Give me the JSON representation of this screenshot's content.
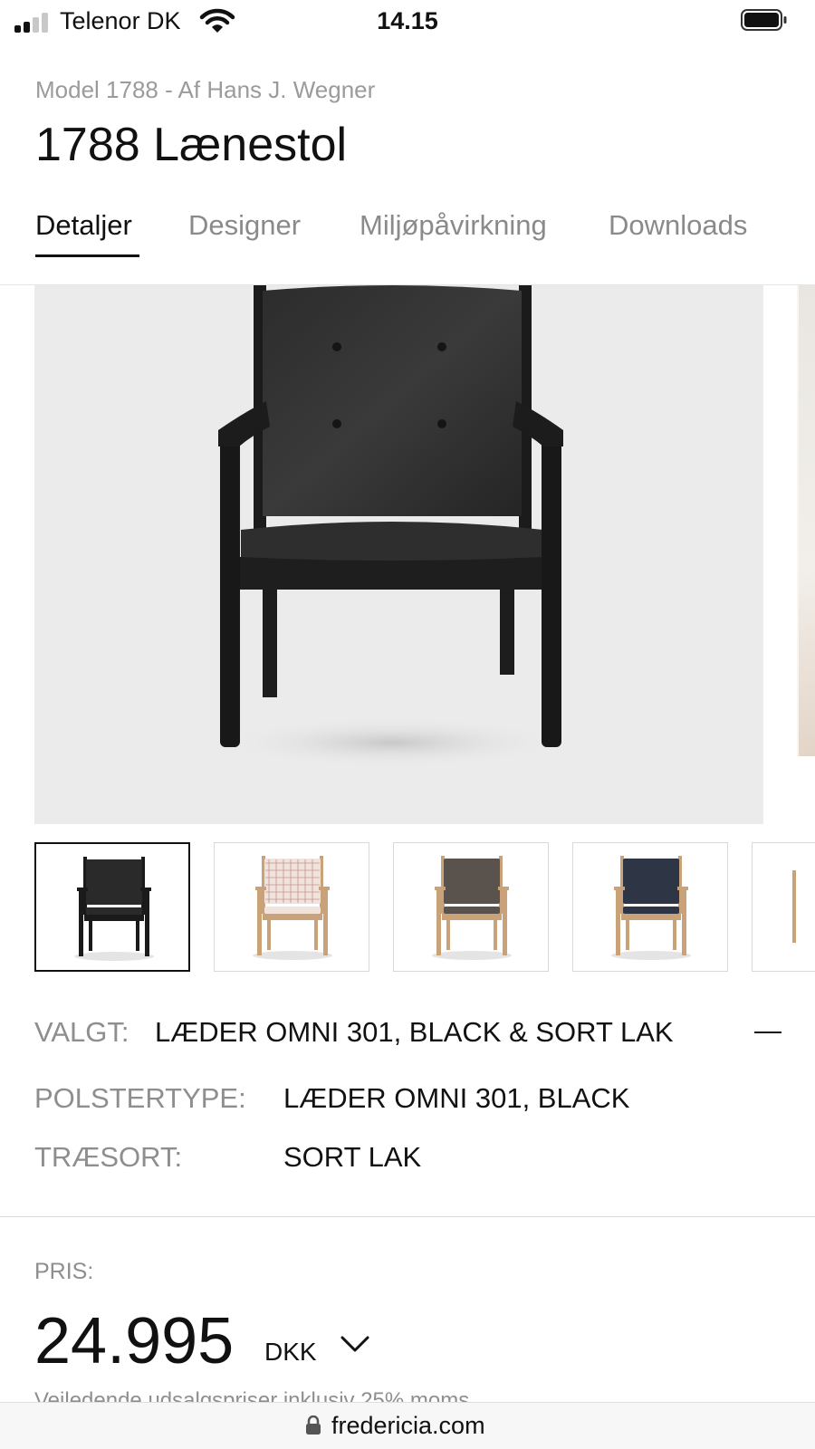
{
  "status_bar": {
    "carrier": "Telenor DK",
    "time": "14.15"
  },
  "product": {
    "subtitle": "Model 1788 - Af Hans J. Wegner",
    "title": "1788 Lænestol"
  },
  "tabs": [
    {
      "label": "Detaljer",
      "active": true
    },
    {
      "label": "Designer",
      "active": false
    },
    {
      "label": "Miljøpåvirkning",
      "active": false
    },
    {
      "label": "Downloads",
      "active": false
    }
  ],
  "gallery": {
    "hero_icon": "black-leather-armchair",
    "thumbnails": [
      {
        "icon": "black-leather-armchair-thumb",
        "selected": true,
        "frame": "#1a1a1a",
        "upholstery": "#2a2a2a"
      },
      {
        "icon": "checked-fabric-armchair-thumb",
        "selected": false,
        "frame": "#c9a27a",
        "upholstery": "#efe3dc"
      },
      {
        "icon": "grey-fabric-armchair-thumb",
        "selected": false,
        "frame": "#c9a27a",
        "upholstery": "#5a524c"
      },
      {
        "icon": "navy-fabric-armchair-thumb",
        "selected": false,
        "frame": "#c9a27a",
        "upholstery": "#2e3545"
      }
    ]
  },
  "selection": {
    "label": "VALGT:",
    "value": "LÆDER OMNI 301, BLACK & SORT LAK",
    "specs": [
      {
        "label": "POLSTERTYPE:",
        "value": "LÆDER OMNI 301, BLACK"
      },
      {
        "label": "TRÆSORT:",
        "value": "SORT LAK"
      }
    ]
  },
  "price": {
    "label": "PRIS:",
    "amount": "24.995",
    "currency": "DKK",
    "note": "Vejledende udsalgspriser inklusiv 25% moms"
  },
  "browser": {
    "url": "fredericia.com"
  }
}
